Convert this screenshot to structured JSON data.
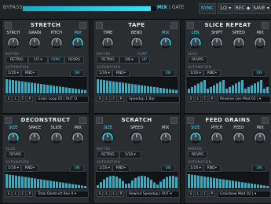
{
  "topbar": {
    "bypass": "BYPASS",
    "mix_label": "MIX",
    "gate_label": "GATE",
    "mix_level": 0.96,
    "sync": "SYNC",
    "div": "1/2 ▾",
    "rec": "REC ◆",
    "save": "SAVE ▾"
  },
  "common": {
    "buffer": "BUFFER",
    "automation": "AUTOMATION",
    "rnd": "RND• All",
    "on": "ON",
    "s": "S",
    "l": "L",
    "c": "C",
    "p": "P"
  },
  "panels": [
    {
      "title": "STRETCH",
      "knobs": [
        "STRCH",
        "GRAIN",
        "PITCH",
        "MIX"
      ],
      "accent_knob": 3,
      "section": "BUFFER",
      "section2": "",
      "buttons": [
        "RETRIG",
        "1/1 ▾",
        "SYNC",
        "REVRS"
      ],
      "preset": "Grain Loop 02 | RUT D"
    },
    {
      "title": "TAPE",
      "knobs": [
        "TIME",
        "BEND",
        "MIX"
      ],
      "accent_knob": 2,
      "section": "BUFFER",
      "section2": "RAMP",
      "buttons": [
        "RETRIG",
        "1/8 ▾",
        "UP"
      ],
      "preset": "Speedup 1 Bar"
    },
    {
      "title": "SLICE REPEAT",
      "knobs": [
        "LEN",
        "SHIFT",
        "SPEED",
        "MIX"
      ],
      "accent_knob": 0,
      "section": "SLICE",
      "section2": "",
      "buttons": [
        "REVRS"
      ],
      "preset": "Reverse Len Mod 02 | ▾"
    },
    {
      "title": "DECONSTRUCT",
      "knobs": [
        "SIZE",
        "SPACE",
        "SLIDE",
        "MIX"
      ],
      "accent_knob": 0,
      "section": "SLICE",
      "section2": "",
      "buttons": [
        "REVRS"
      ],
      "preset": "Total Destruct Rev 0 ▾"
    },
    {
      "title": "SCRATCH",
      "knobs": [
        "SIZE",
        "SPEED",
        "MIX"
      ],
      "accent_knob": 0,
      "section": "BUFFER",
      "section2": "",
      "buttons": [
        "RETRIG",
        "1/16 ▾"
      ],
      "preset": "Rewind Speedup | RUT ▾"
    },
    {
      "title": "FEED GRAINS",
      "knobs": [
        "SIZE",
        "PITCH",
        "FEED",
        "MIX"
      ],
      "accent_knob": 0,
      "section": "SPREAD",
      "section2": "",
      "buttons": [
        "REVRS"
      ],
      "preset": "Grainbow Mod 02 | ▾"
    }
  ],
  "colors": {
    "accent": "#36e0ff",
    "panel": "#2a2e31",
    "bg": "#1b1e21"
  }
}
